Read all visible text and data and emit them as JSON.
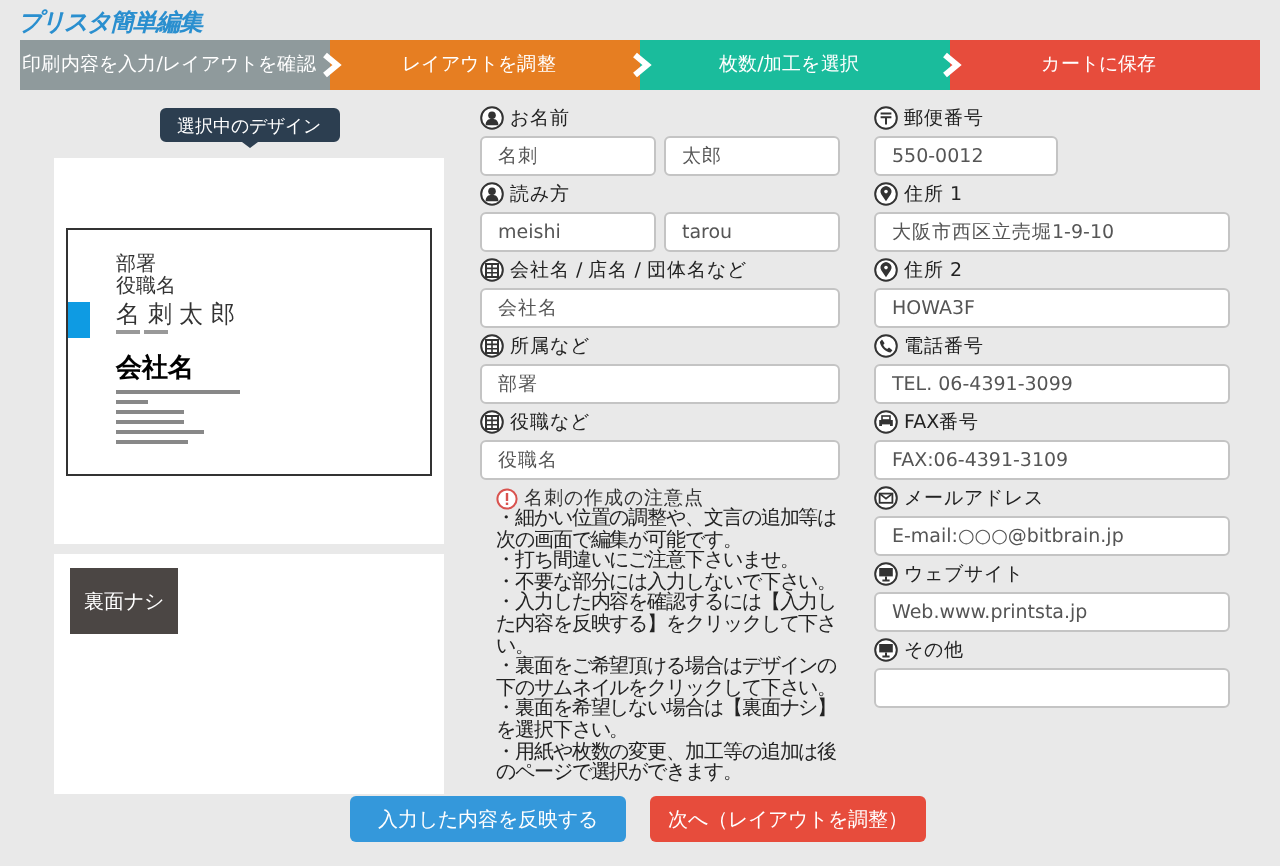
{
  "logo": "プリスタ簡単編集",
  "steps": [
    {
      "label": "印刷内容を入力/レイアウトを確認",
      "color": "#8f9a9c"
    },
    {
      "label": "レイアウトを調整",
      "color": "#e67e22"
    },
    {
      "label": "枚数/加工を選択",
      "color": "#1abc9c"
    },
    {
      "label": "カートに保存",
      "color": "#e74c3c"
    }
  ],
  "preview": {
    "tooltip": "選択中のデザイン",
    "card": {
      "department": "部署",
      "job_title": "役職名",
      "name": "名 刺 太 郎",
      "company": "会社名"
    },
    "back_option": "裏面ナシ"
  },
  "form_left": [
    {
      "label": "お名前",
      "kind": "person",
      "inputs": [
        {
          "kind": "half",
          "value": "名刺"
        },
        {
          "kind": "half",
          "value": "太郎"
        }
      ]
    },
    {
      "label": "読み方",
      "kind": "person",
      "inputs": [
        {
          "kind": "half",
          "value": "meishi"
        },
        {
          "kind": "half",
          "value": "tarou"
        }
      ]
    },
    {
      "label": "会社名 / 店名 / 団体名など",
      "kind": "building",
      "inputs": [
        {
          "kind": "full",
          "value": "会社名"
        }
      ]
    },
    {
      "label": "所属など",
      "kind": "building",
      "inputs": [
        {
          "kind": "full",
          "value": "部署"
        }
      ]
    },
    {
      "label": "役職など",
      "kind": "building",
      "inputs": [
        {
          "kind": "full",
          "value": "役職名"
        }
      ]
    }
  ],
  "notice": {
    "heading": "名刺の作成の注意点",
    "items": [
      "・細かい位置の調整や、文言の追加等は次の画面で編集が可能です。",
      "・打ち間違いにご注意下さいませ。",
      "・不要な部分には入力しないで下さい。",
      "・入力した内容を確認するには【入力した内容を反映する】をクリックして下さい。",
      "・裏面をご希望頂ける場合はデザインの下のサムネイルをクリックして下さい。",
      "・裏面を希望しない場合は【裏面ナシ】を選択下さい。",
      "・用紙や枚数の変更、加工等の追加は後のページで選択ができます。"
    ]
  },
  "form_right": [
    {
      "label": "郵便番号",
      "kind": "postal",
      "inputs": [
        {
          "kind": "short",
          "value": "550-0012"
        }
      ]
    },
    {
      "label": "住所 1",
      "kind": "pin",
      "inputs": [
        {
          "kind": "full",
          "value": "大阪市西区立売堀1-9-10"
        }
      ]
    },
    {
      "label": "住所 2",
      "kind": "pin",
      "inputs": [
        {
          "kind": "full",
          "value": "HOWA3F"
        }
      ]
    },
    {
      "label": "電話番号",
      "kind": "phone",
      "inputs": [
        {
          "kind": "full",
          "value": "TEL. 06-4391-3099"
        }
      ]
    },
    {
      "label": "FAX番号",
      "kind": "fax",
      "inputs": [
        {
          "kind": "full",
          "value": "FAX:06-4391-3109"
        }
      ]
    },
    {
      "label": "メールアドレス",
      "kind": "mail",
      "inputs": [
        {
          "kind": "full",
          "value": "E-mail:○○○@bitbrain.jp"
        }
      ]
    },
    {
      "label": "ウェブサイト",
      "kind": "web",
      "inputs": [
        {
          "kind": "full",
          "value": "Web.www.printsta.jp"
        }
      ]
    },
    {
      "label": "その他",
      "kind": "web",
      "inputs": [
        {
          "kind": "full"
        }
      ]
    }
  ],
  "buttons": [
    {
      "label": "入力した内容を反映する",
      "color": "#3498db"
    },
    {
      "label": "次へ（レイアウトを調整）",
      "color": "#e74c3c"
    }
  ]
}
